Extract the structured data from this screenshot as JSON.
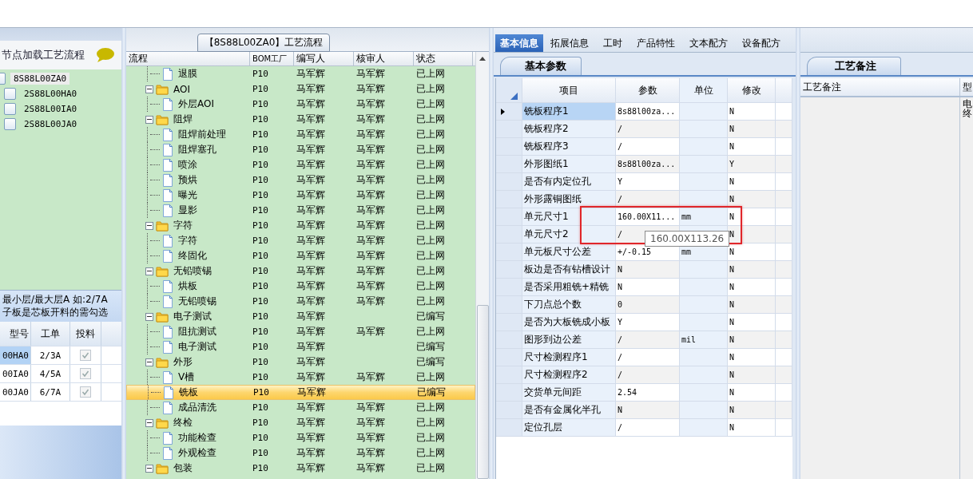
{
  "left_panel": {
    "title": "节点加载工艺流程",
    "tree": [
      {
        "label": "8S88L00ZA0",
        "checked": false,
        "selected": true,
        "children": [
          {
            "label": "2S88L00HA0",
            "checked": false,
            "selected": false
          },
          {
            "label": "2S88L00IA0",
            "checked": false,
            "selected": false
          },
          {
            "label": "2S88L00JA0",
            "checked": false,
            "selected": false
          }
        ]
      }
    ],
    "note": [
      "最小层/最大层A 如:2/7A",
      "子板是芯板开料的需勾选"
    ],
    "grid": {
      "columns": [
        "型号",
        "工单",
        "投料"
      ],
      "rows": [
        {
          "model": "00HA0",
          "order": "2/3A",
          "fed": true,
          "selected": true
        },
        {
          "model": "00IA0",
          "order": "4/5A",
          "fed": true,
          "selected": false
        },
        {
          "model": "00JA0",
          "order": "6/7A",
          "fed": true,
          "selected": false
        }
      ]
    }
  },
  "flow_panel": {
    "title": "【8S88L00ZA0】工艺流程",
    "columns": [
      "流程",
      "BOM工厂",
      "编写人",
      "核审人",
      "状态"
    ],
    "tree": [
      {
        "kind": "hidden",
        "children": [
          {
            "name": "退膜",
            "bom": "P10",
            "writer": "马军辉",
            "reviewer": "马军辉",
            "status": "已上网",
            "selected": false
          }
        ]
      },
      {
        "kind": "folder",
        "name": "AOI",
        "bom": "P10",
        "writer": "马军辉",
        "reviewer": "马军辉",
        "status": "已上网",
        "selected": false,
        "expanded": true,
        "children": [
          {
            "name": "外层AOI",
            "bom": "P10",
            "writer": "马军辉",
            "reviewer": "马军辉",
            "status": "已上网",
            "selected": false
          }
        ]
      },
      {
        "kind": "folder",
        "name": "阻焊",
        "bom": "P10",
        "writer": "马军辉",
        "reviewer": "马军辉",
        "status": "已上网",
        "selected": false,
        "expanded": true,
        "children": [
          {
            "name": "阻焊前处理",
            "bom": "P10",
            "writer": "马军辉",
            "reviewer": "马军辉",
            "status": "已上网",
            "selected": false
          },
          {
            "name": "阻焊塞孔",
            "bom": "P10",
            "writer": "马军辉",
            "reviewer": "马军辉",
            "status": "已上网",
            "selected": false
          },
          {
            "name": "喷涂",
            "bom": "P10",
            "writer": "马军辉",
            "reviewer": "马军辉",
            "status": "已上网",
            "selected": false
          },
          {
            "name": "预烘",
            "bom": "P10",
            "writer": "马军辉",
            "reviewer": "马军辉",
            "status": "已上网",
            "selected": false
          },
          {
            "name": "曝光",
            "bom": "P10",
            "writer": "马军辉",
            "reviewer": "马军辉",
            "status": "已上网",
            "selected": false
          },
          {
            "name": "显影",
            "bom": "P10",
            "writer": "马军辉",
            "reviewer": "马军辉",
            "status": "已上网",
            "selected": false
          }
        ]
      },
      {
        "kind": "folder",
        "name": "字符",
        "bom": "P10",
        "writer": "马军辉",
        "reviewer": "马军辉",
        "status": "已上网",
        "selected": false,
        "expanded": true,
        "children": [
          {
            "name": "字符",
            "bom": "P10",
            "writer": "马军辉",
            "reviewer": "马军辉",
            "status": "已上网",
            "selected": false
          },
          {
            "name": "终固化",
            "bom": "P10",
            "writer": "马军辉",
            "reviewer": "马军辉",
            "status": "已上网",
            "selected": false
          }
        ]
      },
      {
        "kind": "folder",
        "name": "无铅喷锡",
        "bom": "P10",
        "writer": "马军辉",
        "reviewer": "马军辉",
        "status": "已上网",
        "selected": false,
        "expanded": true,
        "children": [
          {
            "name": "烘板",
            "bom": "P10",
            "writer": "马军辉",
            "reviewer": "马军辉",
            "status": "已上网",
            "selected": false
          },
          {
            "name": "无铅喷锡",
            "bom": "P10",
            "writer": "马军辉",
            "reviewer": "马军辉",
            "status": "已上网",
            "selected": false
          }
        ]
      },
      {
        "kind": "folder",
        "name": "电子测试",
        "bom": "P10",
        "writer": "马军辉",
        "status": "已编写",
        "selected": false,
        "expanded": true,
        "children": [
          {
            "name": "阻抗测试",
            "bom": "P10",
            "writer": "马军辉",
            "reviewer": "马军辉",
            "status": "已上网",
            "selected": false
          },
          {
            "name": "电子测试",
            "bom": "P10",
            "writer": "马军辉",
            "status": "已编写",
            "selected": false
          }
        ]
      },
      {
        "kind": "folder",
        "name": "外形",
        "bom": "P10",
        "writer": "马军辉",
        "status": "已编写",
        "selected": false,
        "expanded": true,
        "children": [
          {
            "name": "V槽",
            "bom": "P10",
            "writer": "马军辉",
            "reviewer": "马军辉",
            "status": "已上网",
            "selected": false
          },
          {
            "name": "铣板",
            "bom": "P10",
            "writer": "马军辉",
            "status": "已编写",
            "selected": true
          },
          {
            "name": "成品清洗",
            "bom": "P10",
            "writer": "马军辉",
            "reviewer": "马军辉",
            "status": "已上网",
            "selected": false
          }
        ]
      },
      {
        "kind": "folder",
        "name": "终检",
        "bom": "P10",
        "writer": "马军辉",
        "reviewer": "马军辉",
        "status": "已上网",
        "selected": false,
        "expanded": true,
        "children": [
          {
            "name": "功能检查",
            "bom": "P10",
            "writer": "马军辉",
            "reviewer": "马军辉",
            "status": "已上网",
            "selected": false
          },
          {
            "name": "外观检查",
            "bom": "P10",
            "writer": "马军辉",
            "reviewer": "马军辉",
            "status": "已上网",
            "selected": false
          }
        ]
      },
      {
        "kind": "folder",
        "name": "包装",
        "bom": "P10",
        "writer": "马军辉",
        "reviewer": "马军辉",
        "status": "已上网",
        "selected": false,
        "expanded": true
      }
    ]
  },
  "info_panel": {
    "tabs": [
      {
        "label": "基本信息",
        "selected": true
      },
      {
        "label": "拓展信息",
        "selected": false
      },
      {
        "label": "工时",
        "selected": false
      },
      {
        "label": "产品特性",
        "selected": false
      },
      {
        "label": "文本配方",
        "selected": false
      },
      {
        "label": "设备配方",
        "selected": false
      }
    ],
    "subtab": "基本参数",
    "columns": [
      "项目",
      "参数",
      "单位",
      "修改"
    ],
    "rows": [
      {
        "item": "铣板程序1",
        "value": "8s88l00za...",
        "modified": "N",
        "current": true
      },
      {
        "item": "铣板程序2",
        "value": "/",
        "modified": "N",
        "current": false
      },
      {
        "item": "铣板程序3",
        "value": "/",
        "modified": "N",
        "current": false
      },
      {
        "item": "外形图纸1",
        "value": "8s88l00za...",
        "modified": "Y",
        "current": false
      },
      {
        "item": "是否有内定位孔",
        "value": "Y",
        "modified": "N",
        "current": false
      },
      {
        "item": "外形露铜图纸",
        "value": "/",
        "modified": "N",
        "current": false
      },
      {
        "item": "单元尺寸1",
        "value": "160.00X11...",
        "unit": "mm",
        "modified": "N",
        "current": false
      },
      {
        "item": "单元尺寸2",
        "value": "/",
        "modified": "N",
        "current": false
      },
      {
        "item": "单元板尺寸公差",
        "value": "+/-0.15",
        "unit": "mm",
        "modified": "N",
        "current": false
      },
      {
        "item": "板边是否有钻槽设计",
        "value": "N",
        "modified": "N",
        "current": false
      },
      {
        "item": "是否采用粗铣+精铣",
        "value": "N",
        "modified": "N",
        "current": false
      },
      {
        "item": "下刀点总个数",
        "value": "0",
        "modified": "N",
        "current": false
      },
      {
        "item": "是否为大板铣成小板",
        "value": "Y",
        "modified": "N",
        "current": false
      },
      {
        "item": "图形到边公差",
        "value": "/",
        "unit": "mil",
        "modified": "N",
        "current": false
      },
      {
        "item": "尺寸检测程序1",
        "value": "/",
        "modified": "N",
        "current": false
      },
      {
        "item": "尺寸检测程序2",
        "value": "/",
        "modified": "N",
        "current": false
      },
      {
        "item": "交货单元间距",
        "value": "2.54",
        "modified": "N",
        "current": false
      },
      {
        "item": "是否有金属化半孔",
        "value": "N",
        "modified": "N",
        "current": false
      },
      {
        "item": "定位孔层",
        "value": "/",
        "modified": "N",
        "current": false
      }
    ],
    "tooltip": "160.00X113.26"
  },
  "notes_panel": {
    "subtab": "工艺备注",
    "columns": [
      "工艺备注",
      "型"
    ],
    "cell": [
      "电",
      "终"
    ]
  }
}
